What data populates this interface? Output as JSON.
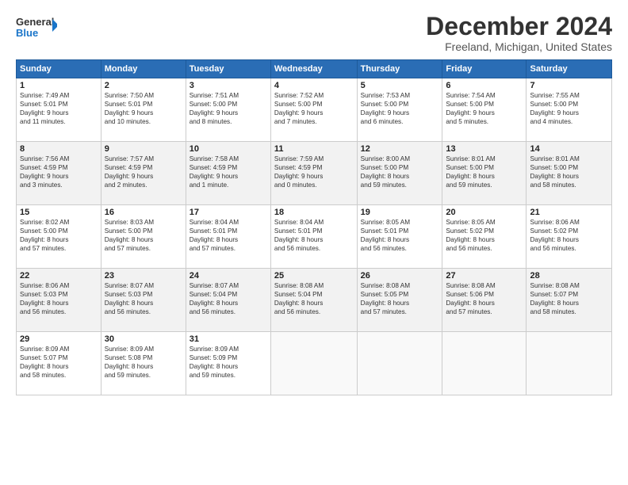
{
  "logo": {
    "line1": "General",
    "line2": "Blue"
  },
  "title": "December 2024",
  "subtitle": "Freeland, Michigan, United States",
  "days_of_week": [
    "Sunday",
    "Monday",
    "Tuesday",
    "Wednesday",
    "Thursday",
    "Friday",
    "Saturday"
  ],
  "weeks": [
    [
      {
        "day": "1",
        "info": "Sunrise: 7:49 AM\nSunset: 5:01 PM\nDaylight: 9 hours\nand 11 minutes."
      },
      {
        "day": "2",
        "info": "Sunrise: 7:50 AM\nSunset: 5:01 PM\nDaylight: 9 hours\nand 10 minutes."
      },
      {
        "day": "3",
        "info": "Sunrise: 7:51 AM\nSunset: 5:00 PM\nDaylight: 9 hours\nand 8 minutes."
      },
      {
        "day": "4",
        "info": "Sunrise: 7:52 AM\nSunset: 5:00 PM\nDaylight: 9 hours\nand 7 minutes."
      },
      {
        "day": "5",
        "info": "Sunrise: 7:53 AM\nSunset: 5:00 PM\nDaylight: 9 hours\nand 6 minutes."
      },
      {
        "day": "6",
        "info": "Sunrise: 7:54 AM\nSunset: 5:00 PM\nDaylight: 9 hours\nand 5 minutes."
      },
      {
        "day": "7",
        "info": "Sunrise: 7:55 AM\nSunset: 5:00 PM\nDaylight: 9 hours\nand 4 minutes."
      }
    ],
    [
      {
        "day": "8",
        "info": "Sunrise: 7:56 AM\nSunset: 4:59 PM\nDaylight: 9 hours\nand 3 minutes."
      },
      {
        "day": "9",
        "info": "Sunrise: 7:57 AM\nSunset: 4:59 PM\nDaylight: 9 hours\nand 2 minutes."
      },
      {
        "day": "10",
        "info": "Sunrise: 7:58 AM\nSunset: 4:59 PM\nDaylight: 9 hours\nand 1 minute."
      },
      {
        "day": "11",
        "info": "Sunrise: 7:59 AM\nSunset: 4:59 PM\nDaylight: 9 hours\nand 0 minutes."
      },
      {
        "day": "12",
        "info": "Sunrise: 8:00 AM\nSunset: 5:00 PM\nDaylight: 8 hours\nand 59 minutes."
      },
      {
        "day": "13",
        "info": "Sunrise: 8:01 AM\nSunset: 5:00 PM\nDaylight: 8 hours\nand 59 minutes."
      },
      {
        "day": "14",
        "info": "Sunrise: 8:01 AM\nSunset: 5:00 PM\nDaylight: 8 hours\nand 58 minutes."
      }
    ],
    [
      {
        "day": "15",
        "info": "Sunrise: 8:02 AM\nSunset: 5:00 PM\nDaylight: 8 hours\nand 57 minutes."
      },
      {
        "day": "16",
        "info": "Sunrise: 8:03 AM\nSunset: 5:00 PM\nDaylight: 8 hours\nand 57 minutes."
      },
      {
        "day": "17",
        "info": "Sunrise: 8:04 AM\nSunset: 5:01 PM\nDaylight: 8 hours\nand 57 minutes."
      },
      {
        "day": "18",
        "info": "Sunrise: 8:04 AM\nSunset: 5:01 PM\nDaylight: 8 hours\nand 56 minutes."
      },
      {
        "day": "19",
        "info": "Sunrise: 8:05 AM\nSunset: 5:01 PM\nDaylight: 8 hours\nand 56 minutes."
      },
      {
        "day": "20",
        "info": "Sunrise: 8:05 AM\nSunset: 5:02 PM\nDaylight: 8 hours\nand 56 minutes."
      },
      {
        "day": "21",
        "info": "Sunrise: 8:06 AM\nSunset: 5:02 PM\nDaylight: 8 hours\nand 56 minutes."
      }
    ],
    [
      {
        "day": "22",
        "info": "Sunrise: 8:06 AM\nSunset: 5:03 PM\nDaylight: 8 hours\nand 56 minutes."
      },
      {
        "day": "23",
        "info": "Sunrise: 8:07 AM\nSunset: 5:03 PM\nDaylight: 8 hours\nand 56 minutes."
      },
      {
        "day": "24",
        "info": "Sunrise: 8:07 AM\nSunset: 5:04 PM\nDaylight: 8 hours\nand 56 minutes."
      },
      {
        "day": "25",
        "info": "Sunrise: 8:08 AM\nSunset: 5:04 PM\nDaylight: 8 hours\nand 56 minutes."
      },
      {
        "day": "26",
        "info": "Sunrise: 8:08 AM\nSunset: 5:05 PM\nDaylight: 8 hours\nand 57 minutes."
      },
      {
        "day": "27",
        "info": "Sunrise: 8:08 AM\nSunset: 5:06 PM\nDaylight: 8 hours\nand 57 minutes."
      },
      {
        "day": "28",
        "info": "Sunrise: 8:08 AM\nSunset: 5:07 PM\nDaylight: 8 hours\nand 58 minutes."
      }
    ],
    [
      {
        "day": "29",
        "info": "Sunrise: 8:09 AM\nSunset: 5:07 PM\nDaylight: 8 hours\nand 58 minutes."
      },
      {
        "day": "30",
        "info": "Sunrise: 8:09 AM\nSunset: 5:08 PM\nDaylight: 8 hours\nand 59 minutes."
      },
      {
        "day": "31",
        "info": "Sunrise: 8:09 AM\nSunset: 5:09 PM\nDaylight: 8 hours\nand 59 minutes."
      },
      {
        "day": "",
        "info": ""
      },
      {
        "day": "",
        "info": ""
      },
      {
        "day": "",
        "info": ""
      },
      {
        "day": "",
        "info": ""
      }
    ]
  ]
}
